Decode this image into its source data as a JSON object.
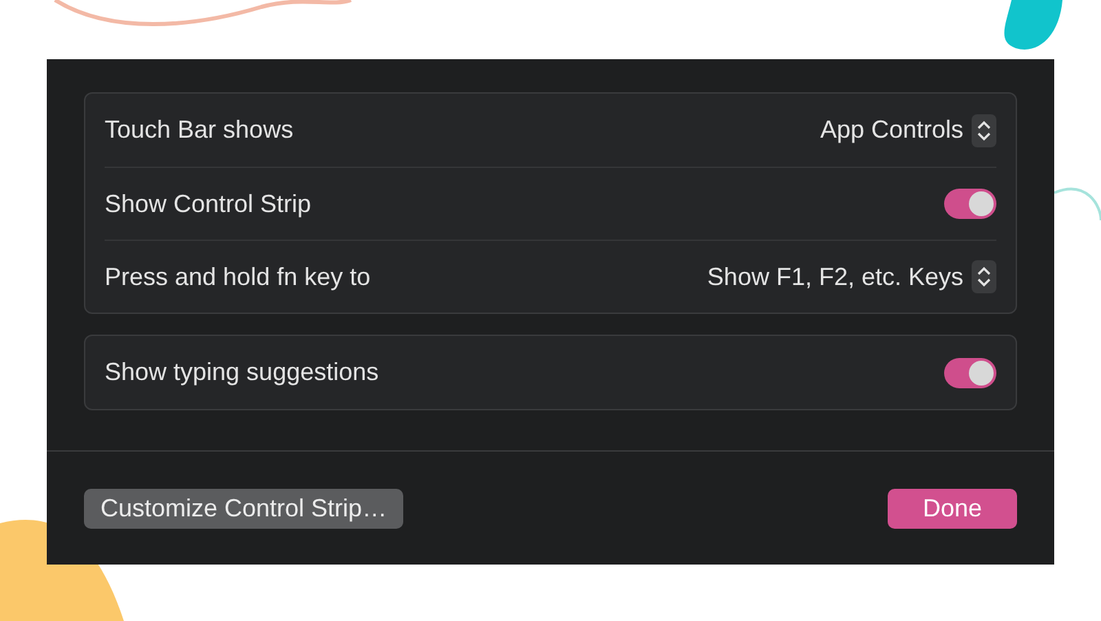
{
  "groups": [
    {
      "rows": [
        {
          "kind": "popup",
          "label": "Touch Bar shows",
          "value": "App Controls"
        },
        {
          "kind": "toggle",
          "label": "Show Control Strip",
          "on": true
        },
        {
          "kind": "popup",
          "label": "Press and hold fn key to",
          "value": "Show F1, F2, etc. Keys"
        }
      ]
    },
    {
      "rows": [
        {
          "kind": "toggle",
          "label": "Show typing suggestions",
          "on": true
        }
      ]
    }
  ],
  "buttons": [
    {
      "label": "Customize Control Strip…",
      "kind": "secondary"
    },
    {
      "label": "Done",
      "kind": "primary"
    }
  ]
}
